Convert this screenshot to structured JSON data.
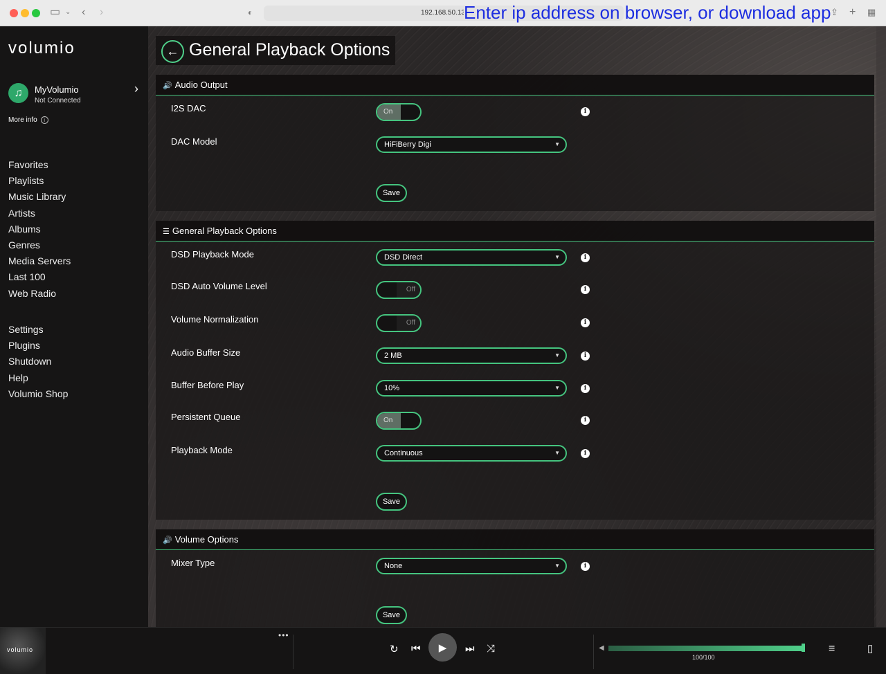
{
  "browser": {
    "address": "192.168.50.132",
    "banner": "Enter ip address on browser, or download app"
  },
  "sidebar": {
    "logo": "volumio",
    "myvolumio": {
      "title": "MyVolumio",
      "status": "Not Connected"
    },
    "more_info": "More info",
    "nav_primary": [
      "Favorites",
      "Playlists",
      "Music Library",
      "Artists",
      "Albums",
      "Genres",
      "Media Servers",
      "Last 100",
      "Web Radio"
    ],
    "nav_secondary": [
      "Settings",
      "Plugins",
      "Shutdown",
      "Help",
      "Volumio Shop"
    ]
  },
  "page": {
    "title": "General Playback Options"
  },
  "sections": {
    "audio_output": {
      "title": "Audio Output",
      "i2s_dac": {
        "label": "I2S DAC",
        "state": "On"
      },
      "dac_model": {
        "label": "DAC Model",
        "value": "HiFiBerry Digi"
      },
      "save": "Save"
    },
    "general": {
      "title": "General Playback Options",
      "dsd_mode": {
        "label": "DSD Playback Mode",
        "value": "DSD Direct"
      },
      "dsd_auto_volume": {
        "label": "DSD Auto Volume Level",
        "state": "Off"
      },
      "volume_normalization": {
        "label": "Volume Normalization",
        "state": "Off"
      },
      "audio_buffer": {
        "label": "Audio Buffer Size",
        "value": "2 MB"
      },
      "buffer_before_play": {
        "label": "Buffer Before Play",
        "value": "10%"
      },
      "persistent_queue": {
        "label": "Persistent Queue",
        "state": "On"
      },
      "playback_mode": {
        "label": "Playback Mode",
        "value": "Continuous"
      },
      "save": "Save"
    },
    "volume": {
      "title": "Volume Options",
      "mixer_type": {
        "label": "Mixer Type",
        "value": "None"
      },
      "save": "Save"
    }
  },
  "player": {
    "album_logo": "volumio",
    "volume": 1.0,
    "volume_text": "100/100"
  },
  "colors": {
    "accent": "#45c47f",
    "sidebar_bg": "#161515",
    "myvolumio_icon": "#2ea86a"
  }
}
